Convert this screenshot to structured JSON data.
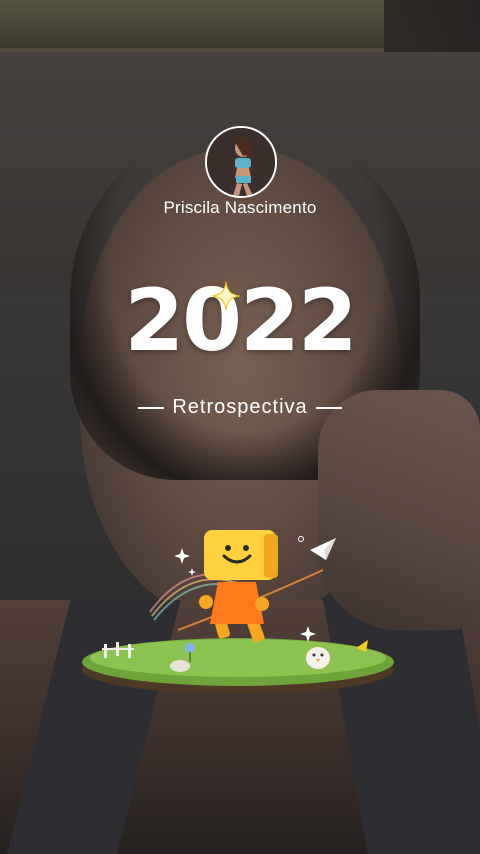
{
  "profile": {
    "name": "Priscila Nascimento"
  },
  "recap": {
    "year": "2022",
    "label": "Retrospectiva"
  },
  "icons": {
    "sparkle": "sparkle-icon",
    "paper_plane": "paper-plane-icon"
  },
  "colors": {
    "text": "#ffffff",
    "mascot": "#f5a623",
    "grass": "#6ea43a"
  }
}
